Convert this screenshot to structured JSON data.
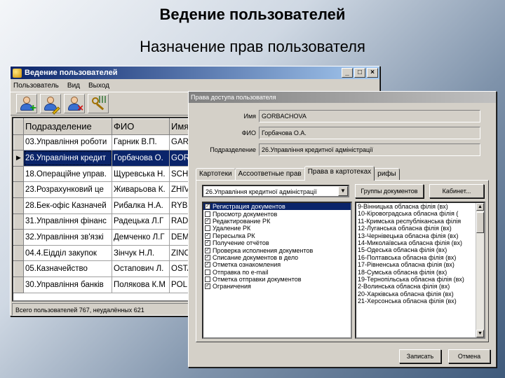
{
  "slide": {
    "title": "Ведение пользователей",
    "subtitle": "Назначение прав пользователя"
  },
  "main_window": {
    "title": "Ведение пользователей",
    "controls": [
      "_",
      "□",
      "×"
    ],
    "menu": [
      "Пользователь",
      "Вид",
      "Выход"
    ],
    "toolbar_icons": [
      "add-user-icon",
      "edit-user-icon",
      "delete-user-icon",
      "access-rights-icon"
    ],
    "columns": [
      "Подразделение",
      "ФИО",
      "Имя"
    ],
    "rows": [
      {
        "dept": "03.Управління роботи",
        "fio": "Гарник В.П.",
        "login": "GAR"
      },
      {
        "dept": "26.Управління кредит",
        "fio": "Горбачова О.",
        "login": "GOR"
      },
      {
        "dept": "18.Операційне управ.",
        "fio": "Щурeвська Н.",
        "login": "SCHU"
      },
      {
        "dept": "23.Розрахунковий це",
        "fio": "Живарьова К.",
        "login": "ZHIV"
      },
      {
        "dept": "28.Бек-офіс Казначей",
        "fio": "Рибалка Н.А.",
        "login": "RYB"
      },
      {
        "dept": "31.Управління фінанс",
        "fio": "Радецька Л.Г",
        "login": "RAD"
      },
      {
        "dept": "32.Управління зв'язкі",
        "fio": "Демченко Л.Г",
        "login": "DEM"
      },
      {
        "dept": "04.4.Еідділ закупок",
        "fio": "Зінчук Н.Л.",
        "login": "ZINC"
      },
      {
        "dept": "05.Казначейство",
        "fio": "Остапович Л.",
        "login": "OSTA"
      },
      {
        "dept": "30.Управління банків",
        "fio": "Полякова К.М",
        "login": "POL"
      }
    ],
    "selected_row": 1,
    "status": "Всего пользователей 767, неудалённых 621"
  },
  "rights_dialog": {
    "title": "Права доступа пользователя",
    "fields": [
      {
        "label": "Имя",
        "value": "GORBACHOVA"
      },
      {
        "label": "ФИО",
        "value": "Горбачова О.А."
      },
      {
        "label": "Подразделение",
        "value": "26.Управління кредитної адміністрації"
      }
    ],
    "tabs": [
      "Картотеки",
      "Ассоответные прав",
      "Права в картотеках",
      "рифы"
    ],
    "active_tab": 2,
    "combo_value": "26.Управління кредитної адміністрації",
    "buttons": {
      "doc_group": "Группы документов",
      "cabinet": "Кабинет...",
      "save": "Записать",
      "cancel": "Отмена"
    },
    "rights": [
      {
        "label": "Регистрация документов",
        "checked": true,
        "selected": true
      },
      {
        "label": "Просмотр документов",
        "checked": false
      },
      {
        "label": "Редактирование РК",
        "checked": true
      },
      {
        "label": "Удаление РК",
        "checked": false
      },
      {
        "label": "Пересылка РК",
        "checked": true
      },
      {
        "label": "Получение отчётов",
        "checked": true
      },
      {
        "label": "Проверка исполнения документов",
        "checked": true
      },
      {
        "label": "Списание документов в дело",
        "checked": true
      },
      {
        "label": "Отметка ознакомления",
        "checked": true
      },
      {
        "label": "Отправка по e-mail",
        "checked": false
      },
      {
        "label": "Отметка отправки документов",
        "checked": false
      },
      {
        "label": "Ограничения",
        "checked": true
      }
    ],
    "regions": [
      "9-Вінницька обласна філія (вх)",
      "10-Кіровоградська обласна філія (",
      "11-Кримська республіканська філія",
      "12-Луганська обласна філія (вх)",
      "13-Чернівецька обласна філія (вх)",
      "14-Миколаївська обласна філія (вх)",
      "15-Одеська обласна філія (вх)",
      "16-Полтавська обласна філія (вх)",
      "17-Рівненська обласна філія (вх)",
      "18-Сумська обласна філія (вх)",
      "19-Тернопільська обласна філія (вх)",
      "2-Волинська обласна філія (вх)",
      "20-Харківська обласна філія (вх)",
      "21-Херсонська обласна філія (вх)"
    ]
  }
}
